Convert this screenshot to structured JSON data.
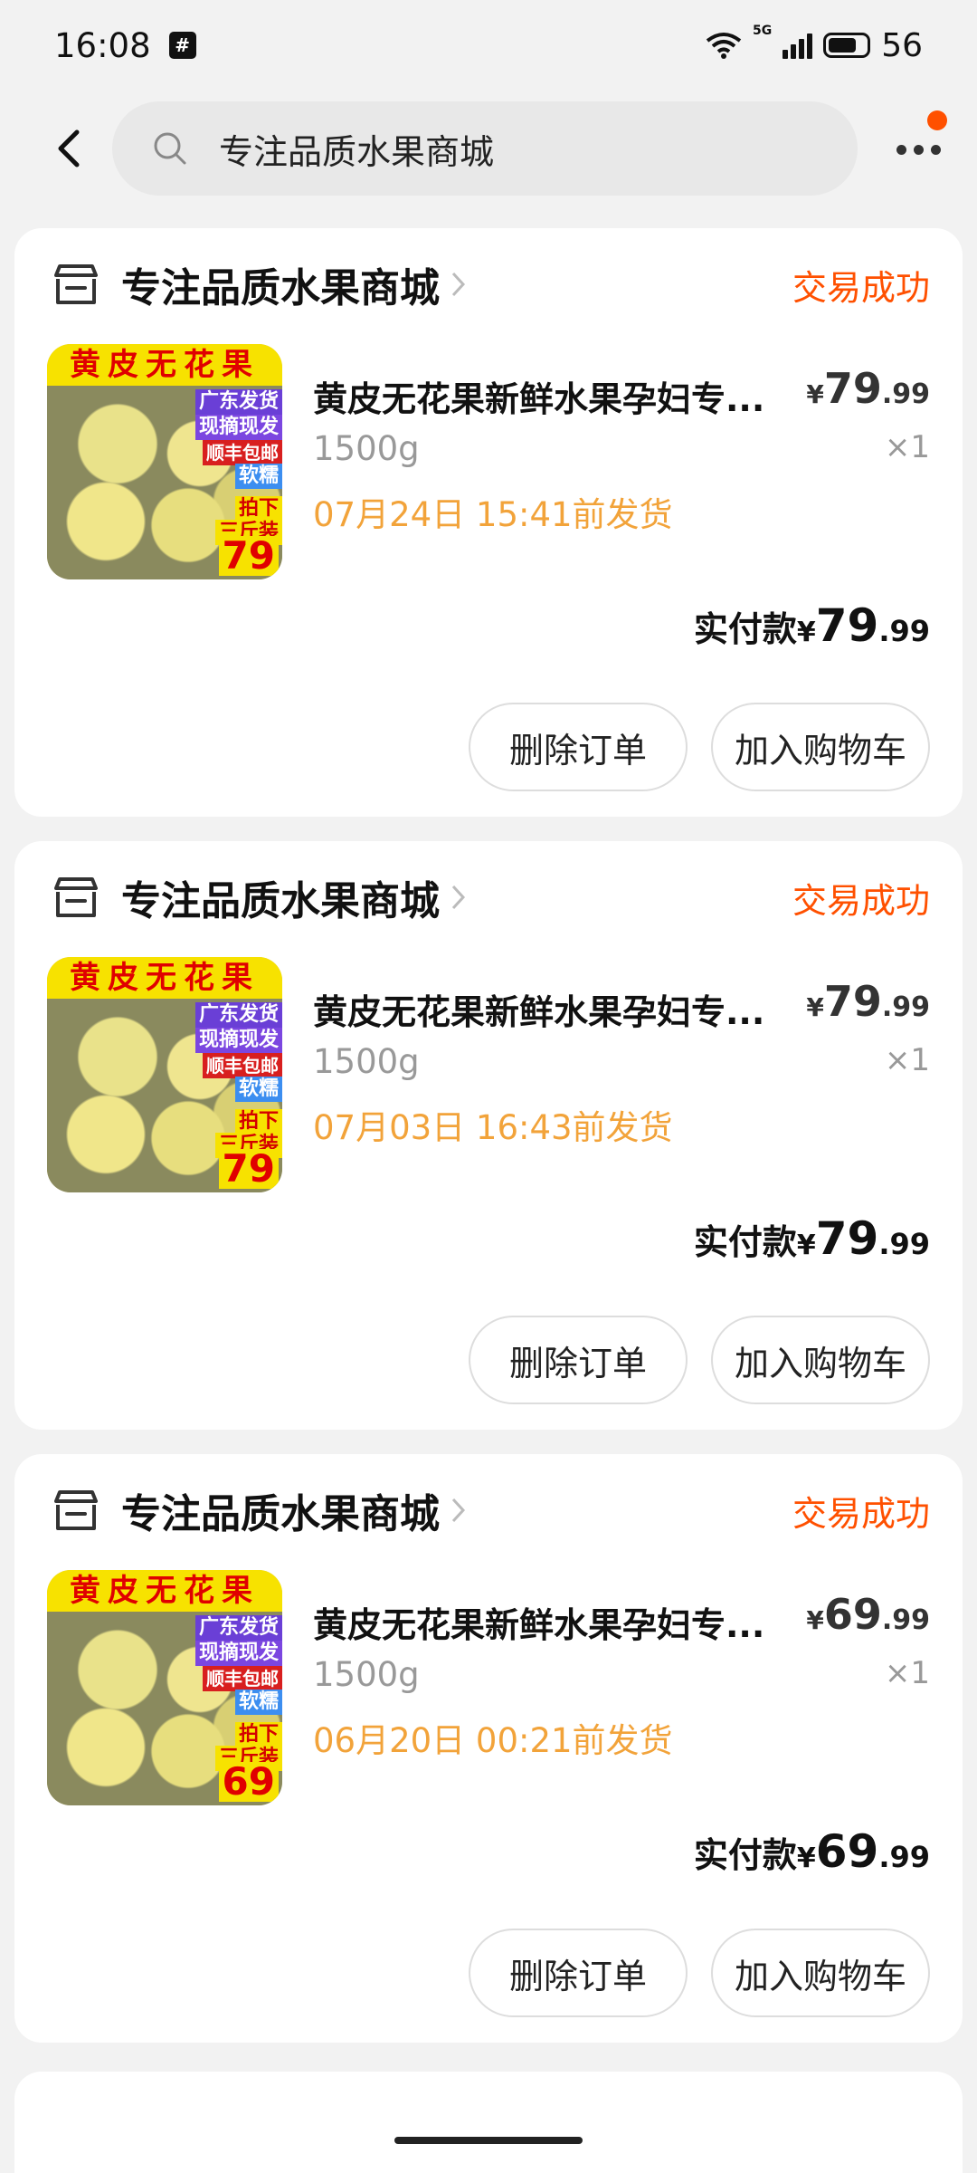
{
  "status_bar": {
    "time": "16:08",
    "app_badge": "#",
    "network": "5G",
    "battery": "56"
  },
  "header": {
    "search_text": "专注品质水果商城",
    "icons": [
      "back-icon",
      "search-icon",
      "more-icon"
    ]
  },
  "orders": [
    {
      "shop_name": "专注品质水果商城",
      "status": "交易成功",
      "title": "黄皮无花果新鲜水果孕妇专...",
      "sku": "1500g",
      "price_symbol": "¥",
      "price_int": "79",
      "price_dec": ".99",
      "qty": "×1",
      "ship_time": "07月24日 15:41前发货",
      "paid_label": "实付款",
      "paid_symbol": "¥",
      "paid_int": "79",
      "paid_dec": ".99",
      "delete_label": "删除订单",
      "cart_label": "加入购物车",
      "thumb": {
        "banner": "黄皮无花果",
        "tag_a": "广东发货",
        "tag_b": "现摘现发",
        "tag_c": "顺丰包邮",
        "tag_d": "软糯",
        "tag_e": "拍下",
        "tag_f": "三斤装",
        "price": "79"
      }
    },
    {
      "shop_name": "专注品质水果商城",
      "status": "交易成功",
      "title": "黄皮无花果新鲜水果孕妇专...",
      "sku": "1500g",
      "price_symbol": "¥",
      "price_int": "79",
      "price_dec": ".99",
      "qty": "×1",
      "ship_time": "07月03日 16:43前发货",
      "paid_label": "实付款",
      "paid_symbol": "¥",
      "paid_int": "79",
      "paid_dec": ".99",
      "delete_label": "删除订单",
      "cart_label": "加入购物车",
      "thumb": {
        "banner": "黄皮无花果",
        "tag_a": "广东发货",
        "tag_b": "现摘现发",
        "tag_c": "顺丰包邮",
        "tag_d": "软糯",
        "tag_e": "拍下",
        "tag_f": "三斤装",
        "price": "79"
      }
    },
    {
      "shop_name": "专注品质水果商城",
      "status": "交易成功",
      "title": "黄皮无花果新鲜水果孕妇专...",
      "sku": "1500g",
      "price_symbol": "¥",
      "price_int": "69",
      "price_dec": ".99",
      "qty": "×1",
      "ship_time": "06月20日 00:21前发货",
      "paid_label": "实付款",
      "paid_symbol": "¥",
      "paid_int": "69",
      "paid_dec": ".99",
      "delete_label": "删除订单",
      "cart_label": "加入购物车",
      "thumb": {
        "banner": "黄皮无花果",
        "tag_a": "广东发货",
        "tag_b": "现摘现发",
        "tag_c": "顺丰包邮",
        "tag_d": "软糯",
        "tag_e": "拍下",
        "tag_f": "三斤装",
        "price": "69"
      }
    }
  ],
  "colors": {
    "accent": "#ff5000",
    "ship_time": "#f2a33a",
    "background": "#f2f2f2"
  }
}
